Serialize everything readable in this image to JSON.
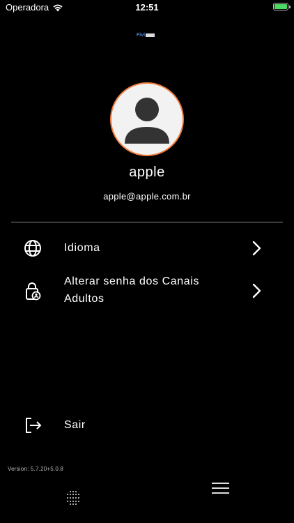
{
  "status_bar": {
    "carrier": "Operadora",
    "time": "12:51",
    "wifi_icon": "wifi-icon",
    "battery_icon": "battery-icon",
    "battery_level": 1.0,
    "battery_color": "#4cd964"
  },
  "brand": {
    "logo_text": "Fivi",
    "logo_icon": "brand-logo"
  },
  "profile": {
    "avatar_icon": "user-avatar-icon",
    "avatar_border_color": "#f07a3c",
    "name": "apple",
    "email": "apple@apple.com.br"
  },
  "menu": {
    "items": [
      {
        "icon": "globe-icon",
        "label": "Idioma",
        "chevron": "chevron-right-icon"
      },
      {
        "icon": "lock-person-icon",
        "label_line1": "Alterar senha dos Canais",
        "label_line2": "Adultos",
        "chevron": "chevron-right-icon"
      }
    ],
    "logout": {
      "icon": "logout-icon",
      "label": "Sair"
    }
  },
  "footer": {
    "version": "Version: 5.7.20+5.0.8",
    "left_icon": "dots-grid-icon",
    "right_icon": "hamburger-menu-icon"
  }
}
